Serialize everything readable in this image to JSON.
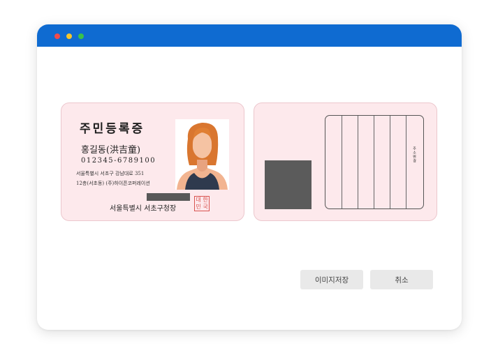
{
  "window": {
    "titlebar_color": "#0f6bd1",
    "traffic_lights": [
      "red-dot",
      "yellow-dot",
      "green-dot"
    ]
  },
  "id_card_front": {
    "title": "주민등록증",
    "name": "홍길동(洪吉童)",
    "resident_number": "012345-6789100",
    "address_line1": "서울특별시 서초구 강남대로 351",
    "address_line2": "12층(서초동) (주)하이픈코퍼레이션",
    "issuer": "서울특별시 서초구청장",
    "seal_text": [
      "대",
      "한",
      "민",
      "국"
    ],
    "photo": "woman-portrait-icon",
    "background_color": "#fde9ec"
  },
  "id_card_back": {
    "vertical_label": "주소변경",
    "background_color": "#fde9ec"
  },
  "actions": {
    "save_label": "이미지저장",
    "cancel_label": "취소"
  }
}
